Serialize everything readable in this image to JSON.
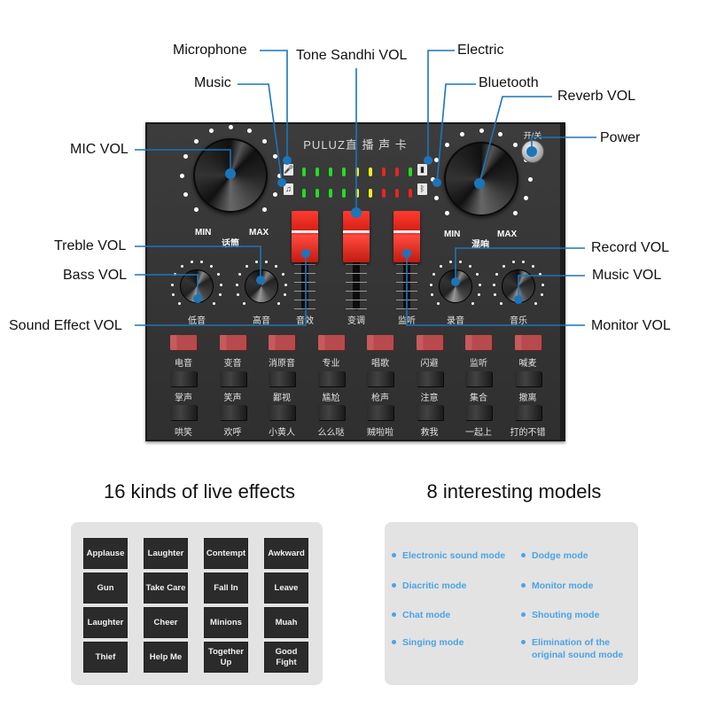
{
  "device": {
    "brand": "PULUZ直 播 声 卡",
    "power_label": "开/关",
    "left_knob": {
      "min": "MIN",
      "max": "MAX",
      "label": "话筒"
    },
    "right_knob": {
      "min": "MIN",
      "max": "MAX",
      "label": "混响"
    },
    "small_knobs": [
      "低音",
      "高音",
      "录音",
      "音乐"
    ],
    "faders": [
      "音效",
      "变调",
      "监听"
    ],
    "indicators": {
      "microphone": "🎤",
      "music": "♫",
      "electric": "▮",
      "bluetooth": "ᛒ"
    },
    "meter_rows": [
      [
        "#22dd22",
        "#22dd22",
        "#22dd22",
        "#22dd22",
        "#eeee22",
        "#eeee22",
        "#ee2222",
        "#ee2222",
        "#22dd22"
      ],
      [
        "#22dd22",
        "#22dd22",
        "#22dd22",
        "#22dd22",
        "#eeee22",
        "#eeee22",
        "#ee2222",
        "#ee2222",
        "#ee2222"
      ]
    ],
    "mode_buttons": [
      "电音",
      "变音",
      "消原音",
      "专业",
      "唱歌",
      "闪避",
      "监听",
      "喊麦"
    ],
    "effect_row1": [
      "掌声",
      "笑声",
      "鄙视",
      "尴尬",
      "枪声",
      "注意",
      "集合",
      "撤离"
    ],
    "effect_row2": [
      "哄笑",
      "欢呼",
      "小黄人",
      "么么哒",
      "贼啦啦",
      "救我",
      "一起上",
      "打的不错"
    ]
  },
  "callouts": {
    "microphone": "Microphone",
    "music": "Music",
    "mic_vol": "MIC VOL",
    "tone_sandhi_vol": "Tone Sandhi VOL",
    "electric": "Electric",
    "bluetooth": "Bluetooth",
    "reverb_vol": "Reverb VOL",
    "power": "Power",
    "treble_vol": "Treble VOL",
    "bass_vol": "Bass VOL",
    "sound_effect_vol": "Sound Effect VOL",
    "record_vol": "Record VOL",
    "music_vol": "Music VOL",
    "monitor_vol": "Monitor VOL"
  },
  "colors": {
    "accent": "#1b75bb",
    "mode_text": "#4aa3e6",
    "panel_bg": "#e3e3e3"
  },
  "effects_panel": {
    "title": "16 kinds of live effects",
    "items": [
      "Applause",
      "Laughter",
      "Contempt",
      "Awkward",
      "Gun",
      "Take Care",
      "Fall In",
      "Leave",
      "Laughter",
      "Cheer",
      "Minions",
      "Muah",
      "Thief",
      "Help Me",
      "Together Up",
      "Good Fight"
    ]
  },
  "models_panel": {
    "title": "8 interesting models",
    "left": [
      "Electronic sound mode",
      "Diacritic mode",
      "Chat mode",
      "Singing mode"
    ],
    "right": [
      "Dodge mode",
      "Monitor mode",
      "Shouting mode",
      "Elimination of the original sound mode"
    ]
  }
}
